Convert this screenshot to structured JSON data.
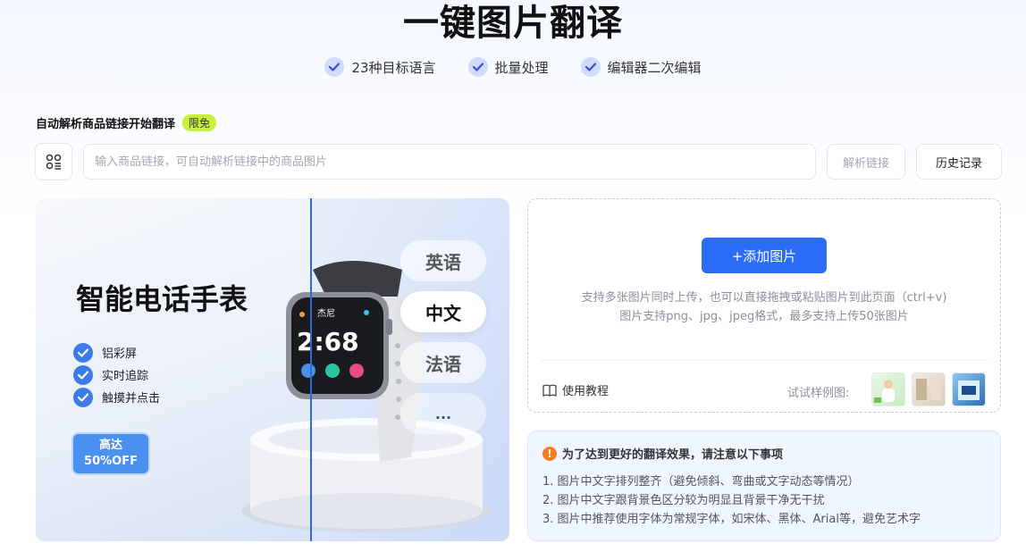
{
  "page": {
    "title": "一键图片翻译"
  },
  "features": [
    {
      "label": "23种目标语言"
    },
    {
      "label": "批量处理"
    },
    {
      "label": "编辑器二次编辑"
    }
  ],
  "link_section": {
    "label": "自动解析商品链接开始翻译",
    "badge": "限免",
    "input_value": "",
    "input_placeholder": "输入商品链接，可自动解析链接中的商品图片",
    "parse_button": "解析链接",
    "history_button": "历史记录"
  },
  "demo": {
    "title": "智能电话手表",
    "features": [
      "铝彩屏",
      "实时追踪",
      "触摸并点击"
    ],
    "promo": [
      "高达",
      "50%OFF"
    ],
    "watch_name": "杰尼",
    "watch_time": "2:68",
    "languages": [
      "英语",
      "中文",
      "法语",
      "..."
    ],
    "selected_language": "中文"
  },
  "upload": {
    "add_button": "+添加图片",
    "hint_line1": "支持多张图片同时上传，也可以直接拖拽或粘贴图片到此页面（ctrl+v)",
    "hint_line2": "图片支持png、jpg、jpeg格式，最多支持上传50张图片",
    "tutorial_link": "使用教程",
    "samples_label": "试试样例图:"
  },
  "notice": {
    "title": "为了达到更好的翻译效果，请注意以下事项",
    "items": [
      "1. 图片中文字排列整齐（避免倾斜、弯曲或文字动态等情况）",
      "2. 图片中文字跟背景色区分较为明显且背景干净无干扰",
      "3. 图片中推荐使用字体为常规字体，如宋体、黑体、Arial等，避免艺术字"
    ]
  },
  "colors": {
    "primary": "#2a6cf6",
    "badge": "#c8f03c",
    "warning": "#f57c1f",
    "check_bg": "#cfdcff"
  }
}
